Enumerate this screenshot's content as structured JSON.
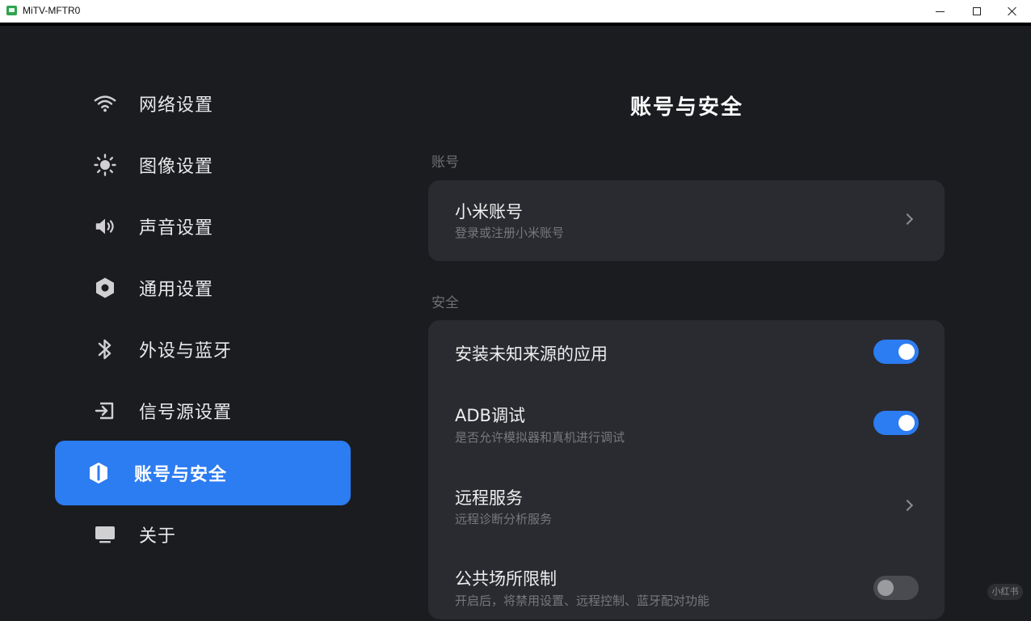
{
  "window": {
    "title": "MiTV-MFTR0"
  },
  "sidebar": {
    "items": [
      {
        "label": "网络设置",
        "icon": "wifi-icon"
      },
      {
        "label": "图像设置",
        "icon": "brightness-icon"
      },
      {
        "label": "声音设置",
        "icon": "speaker-icon"
      },
      {
        "label": "通用设置",
        "icon": "hexagon-settings-icon"
      },
      {
        "label": "外设与蓝牙",
        "icon": "bluetooth-icon"
      },
      {
        "label": "信号源设置",
        "icon": "input-source-icon"
      },
      {
        "label": "账号与安全",
        "icon": "shield-icon",
        "active": true
      },
      {
        "label": "关于",
        "icon": "tv-icon"
      }
    ]
  },
  "main": {
    "title": "账号与安全",
    "account_section": {
      "label": "账号",
      "item": {
        "title": "小米账号",
        "subtitle": "登录或注册小米账号"
      }
    },
    "security_section": {
      "label": "安全",
      "items": [
        {
          "title": "安装未知来源的应用",
          "toggle": "on"
        },
        {
          "title": "ADB调试",
          "subtitle": "是否允许模拟器和真机进行调试",
          "toggle": "on"
        },
        {
          "title": "远程服务",
          "subtitle": "远程诊断分析服务"
        },
        {
          "title": "公共场所限制",
          "subtitle": "开启后，将禁用设置、远程控制、蓝牙配对功能",
          "toggle": "off"
        }
      ]
    }
  },
  "watermark": "小红书",
  "colors": {
    "accent": "#2c7cf2",
    "background": "#1b1c20",
    "card": "#2a2b30"
  }
}
